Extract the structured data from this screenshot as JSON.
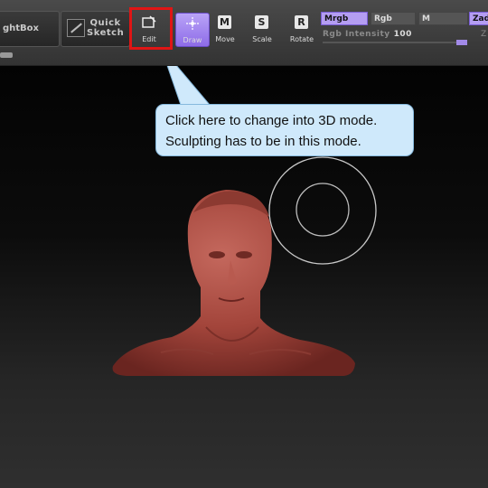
{
  "toolbar": {
    "lightbox_label": "ghtBox",
    "quicksketch_label_1": "Quick",
    "quicksketch_label_2": "Sketch",
    "tools": [
      {
        "label": "Edit",
        "icon": "edit-icon"
      },
      {
        "label": "Draw",
        "icon": "draw-icon"
      },
      {
        "label": "Move",
        "icon": "M"
      },
      {
        "label": "Scale",
        "icon": "S"
      },
      {
        "label": "Rotate",
        "icon": "R"
      }
    ],
    "mrgb": "Mrgb",
    "rgb": "Rgb",
    "m": "M",
    "zadd": "Zad",
    "rgb_intensity_label": "Rgb Intensity",
    "rgb_intensity_value": "100",
    "rgb_intensity_fraction": 1.0,
    "z_label": "Z"
  },
  "callout": {
    "line1": "Click here to change into 3D mode.",
    "line2": "Sculpting has to be in this mode."
  },
  "colors": {
    "accent": "#b49df2",
    "highlight": "#e01515",
    "callout_bg": "#cfe9fb",
    "model": "#a8463c"
  }
}
